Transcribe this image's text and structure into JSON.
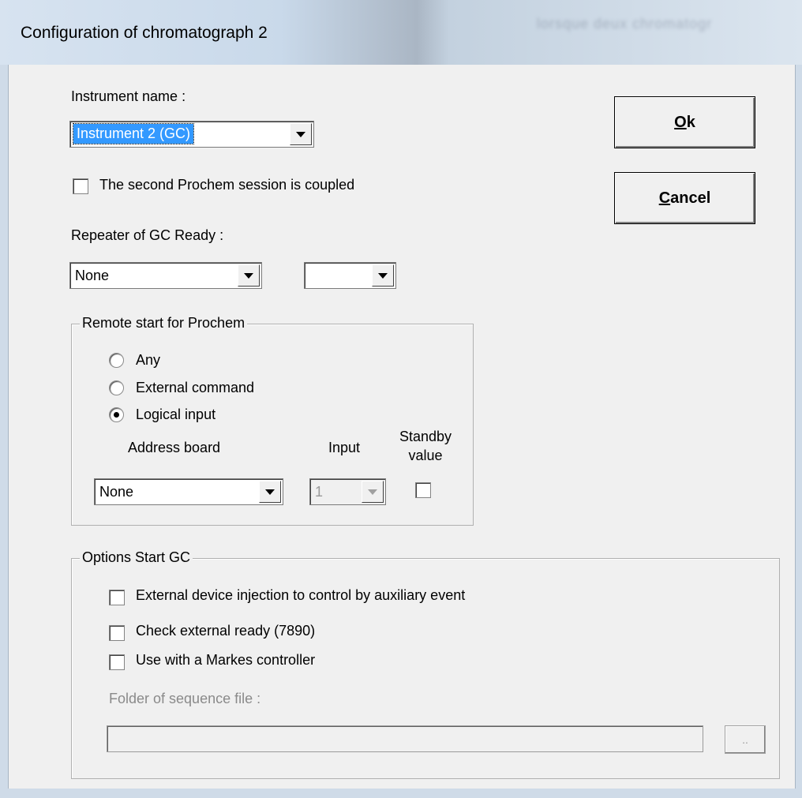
{
  "window": {
    "title": "Configuration of chromatograph 2",
    "background_title": "lorsque deux chromatogr"
  },
  "instrument": {
    "label": "Instrument name :",
    "selected": "Instrument 2 (GC)",
    "coupled_label": "The second Prochem session is coupled",
    "coupled_checked": false
  },
  "repeater": {
    "label": "Repeater of GC Ready :",
    "combo1_value": "None",
    "combo2_value": ""
  },
  "remote_start": {
    "legend": "Remote start for Prochem",
    "options": [
      {
        "label": "Any",
        "checked": false
      },
      {
        "label": "External command",
        "checked": false
      },
      {
        "label": "Logical input",
        "checked": true
      }
    ],
    "address_board_label": "Address board",
    "input_label": "Input",
    "standby_label_line1": "Standby",
    "standby_label_line2": "value",
    "address_board_value": "None",
    "input_value": "1",
    "standby_checked": false
  },
  "options_start": {
    "legend": "Options Start GC",
    "options": [
      {
        "label": "External device injection to control by auxiliary event",
        "checked": false
      },
      {
        "label": "Check external ready (7890)",
        "checked": false
      },
      {
        "label": "Use with a Markes controller",
        "checked": false
      }
    ],
    "folder_label": "Folder of sequence file :",
    "folder_value": "",
    "browse_label": ".."
  },
  "buttons": {
    "ok_accel": "O",
    "ok_rest": "k",
    "cancel_accel": "C",
    "cancel_rest": "ancel"
  },
  "colors": {
    "selection": "#3399ff",
    "dialog_bg": "#f0f0f0"
  }
}
